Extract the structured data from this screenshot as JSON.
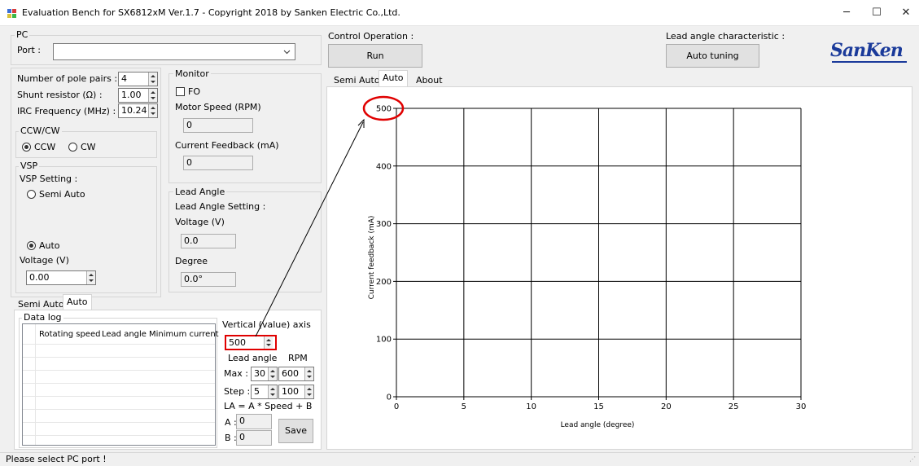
{
  "window": {
    "title": "Evaluation Bench for SX6812xM Ver.1.7 - Copyright 2018 by Sanken Electric Co.,Ltd.",
    "minimize": "─",
    "maximize": "☐",
    "close": "✕"
  },
  "pc": {
    "group": "PC",
    "port_label": "Port :",
    "port_value": ""
  },
  "params": {
    "pole_pairs_label": "Number of pole pairs :",
    "pole_pairs": "4",
    "shunt_label": "Shunt resistor (Ω) :",
    "shunt": "1.00",
    "irc_label": "IRC Frequency (MHz) :",
    "irc": "10.24"
  },
  "direction": {
    "group": "CCW/CW",
    "ccw": "CCW",
    "cw": "CW",
    "selected": "CCW"
  },
  "vsp": {
    "group": "VSP",
    "setting_label": "VSP Setting :",
    "semi_auto": "Semi Auto",
    "auto": "Auto",
    "voltage_label": "Voltage (V)",
    "voltage": "0.00"
  },
  "monitor": {
    "group": "Monitor",
    "fo_label": "FO",
    "speed_label": "Motor Speed (RPM)",
    "speed": "0",
    "current_label": "Current Feedback (mA)",
    "current": "0"
  },
  "lead_angle": {
    "group": "Lead Angle",
    "setting_label": "Lead Angle Setting :",
    "voltage_label": "Voltage (V)",
    "voltage": "0.0",
    "degree_label": "Degree",
    "degree": "0.0°"
  },
  "control": {
    "label": "Control Operation :",
    "run": "Run"
  },
  "lead_char": {
    "label": "Lead angle characteristic :",
    "auto_tuning": "Auto tuning"
  },
  "logo": "SanKen",
  "top_tabs": [
    "Semi Auto",
    "Auto",
    "About"
  ],
  "bottom_tabs": [
    "Semi Auto",
    "Auto"
  ],
  "datalog": {
    "group": "Data log",
    "columns": [
      "Rotating speed",
      "Lead angle",
      "Minimum current"
    ],
    "vaxis_label": "Vertical (value) axis",
    "vaxis_value": "500",
    "lead_angle_hdr": "Lead angle",
    "rpm_hdr": "RPM",
    "max_label": "Max :",
    "max_la": "30",
    "max_rpm": "600",
    "step_label": "Step :",
    "step_la": "5",
    "step_rpm": "100",
    "formula": "LA = A * Speed + B",
    "a_label": "A :",
    "a_value": "0",
    "b_label": "B :",
    "b_value": "0",
    "save": "Save"
  },
  "status": "Please select PC port !",
  "colors": {
    "highlight_red": "#e00000",
    "logo_blue": "#1a3a9a"
  },
  "chart_data": {
    "type": "line",
    "series": [],
    "xlabel": "Lead angle (degree)",
    "ylabel": "Current feedback (mA)",
    "xlim": [
      0,
      30
    ],
    "ylim": [
      0,
      500
    ],
    "xticks": [
      0,
      5,
      10,
      15,
      20,
      25,
      30
    ],
    "yticks": [
      0,
      100,
      200,
      300,
      400,
      500
    ],
    "grid": true
  }
}
